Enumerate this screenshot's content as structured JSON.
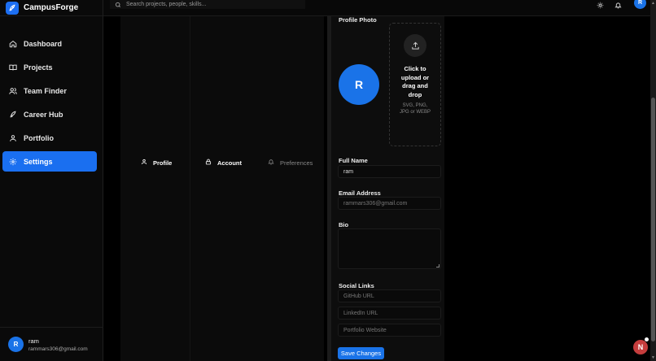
{
  "brand": {
    "name": "CampusForge",
    "logo_icon": "rocket-icon",
    "color": "#1d6ff2"
  },
  "search": {
    "placeholder": "Search projects, people, skills..."
  },
  "nav": {
    "items": [
      {
        "label": "Dashboard",
        "icon": "home-icon"
      },
      {
        "label": "Projects",
        "icon": "book-icon"
      },
      {
        "label": "Team Finder",
        "icon": "users-icon"
      },
      {
        "label": "Career Hub",
        "icon": "rocket-icon"
      },
      {
        "label": "Portfolio",
        "icon": "user-icon"
      },
      {
        "label": "Settings",
        "icon": "gear-icon",
        "active": true
      }
    ]
  },
  "user": {
    "initial": "R",
    "name": "ram",
    "email": "rammars306@gmail.com"
  },
  "topbar": {
    "avatar_initial": "R"
  },
  "tabs": [
    {
      "label": "Profile",
      "icon": "user-icon"
    },
    {
      "label": "Account",
      "icon": "lock-icon"
    },
    {
      "label": "Preferences",
      "icon": "bell-icon"
    }
  ],
  "form": {
    "photo_label": "Profile Photo",
    "photo_initial": "R",
    "upload_title": "Click to upload or drag and drop",
    "upload_sub": "SVG, PNG, JPG or WEBP",
    "full_name_label": "Full Name",
    "full_name_value": "ram",
    "email_label": "Email Address",
    "email_value": "rammars306@gmail.com",
    "bio_label": "Bio",
    "social_label": "Social Links",
    "github_placeholder": "GitHub URL",
    "linkedin_placeholder": "LinkedIn URL",
    "portfolio_placeholder": "Portfolio Website",
    "save_label": "Save Changes"
  },
  "fab": {
    "initial": "N"
  },
  "colors": {
    "accent": "#1a73e8",
    "background": "#000000",
    "fab": "#c53d3d"
  }
}
